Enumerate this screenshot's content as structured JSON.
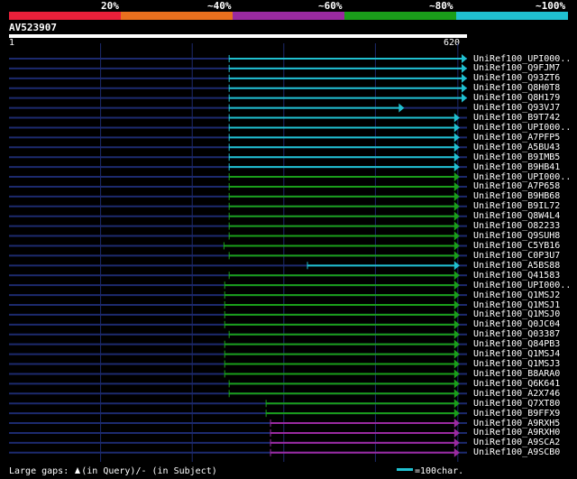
{
  "legend": {
    "segments": [
      {
        "label": "20%",
        "color": "#e8203a"
      },
      {
        "label": "~40%",
        "color": "#e8701e"
      },
      {
        "label": "~60%",
        "color": "#9a2aa0"
      },
      {
        "label": "~80%",
        "color": "#1a9e1a"
      },
      {
        "label": "~100%",
        "color": "#20c0d0"
      }
    ]
  },
  "query": {
    "name": "AV523907",
    "start": "1",
    "end": "620",
    "length": 620
  },
  "colors": {
    "query_line": "#1c2a6e",
    "grid": "#1c2a6e",
    "cyan": "#20c0d0",
    "green": "#1a9e1a",
    "purple": "#9a2aa0"
  },
  "hits": [
    {
      "name": "UniRef100_UPI000..",
      "start": 298,
      "end": 620,
      "color": "cyan"
    },
    {
      "name": "UniRef100_Q9FJM7",
      "start": 298,
      "end": 620,
      "color": "cyan"
    },
    {
      "name": "UniRef100_Q93ZT6",
      "start": 298,
      "end": 620,
      "color": "cyan"
    },
    {
      "name": "UniRef100_Q8H0T8",
      "start": 298,
      "end": 620,
      "color": "cyan"
    },
    {
      "name": "UniRef100_Q8H179",
      "start": 298,
      "end": 620,
      "color": "cyan"
    },
    {
      "name": "UniRef100_Q93VJ7",
      "start": 298,
      "end": 535,
      "color": "cyan"
    },
    {
      "name": "UniRef100_B9T742",
      "start": 298,
      "end": 610,
      "color": "cyan"
    },
    {
      "name": "UniRef100_UPI000..",
      "start": 298,
      "end": 610,
      "color": "cyan"
    },
    {
      "name": "UniRef100_A7PFP5",
      "start": 298,
      "end": 610,
      "color": "cyan"
    },
    {
      "name": "UniRef100_A5BU43",
      "start": 298,
      "end": 610,
      "color": "cyan"
    },
    {
      "name": "UniRef100_B9IMB5",
      "start": 298,
      "end": 610,
      "color": "cyan"
    },
    {
      "name": "UniRef100_B9HB41",
      "start": 298,
      "end": 610,
      "color": "cyan"
    },
    {
      "name": "UniRef100_UPI000..",
      "start": 298,
      "end": 610,
      "color": "green"
    },
    {
      "name": "UniRef100_A7P658",
      "start": 298,
      "end": 610,
      "color": "green"
    },
    {
      "name": "UniRef100_B9HB68",
      "start": 298,
      "end": 610,
      "color": "green"
    },
    {
      "name": "UniRef100_B9IL72",
      "start": 298,
      "end": 610,
      "color": "green"
    },
    {
      "name": "UniRef100_Q8W4L4",
      "start": 298,
      "end": 610,
      "color": "green"
    },
    {
      "name": "UniRef100_O82233",
      "start": 298,
      "end": 610,
      "color": "green"
    },
    {
      "name": "UniRef100_Q9SUH8",
      "start": 298,
      "end": 610,
      "color": "green"
    },
    {
      "name": "UniRef100_C5YB16",
      "start": 291,
      "end": 610,
      "color": "green"
    },
    {
      "name": "UniRef100_C0P3U7",
      "start": 298,
      "end": 610,
      "color": "green"
    },
    {
      "name": "UniRef100_A5BS88",
      "start": 404,
      "end": 610,
      "color": "cyan"
    },
    {
      "name": "UniRef100_Q41583",
      "start": 298,
      "end": 610,
      "color": "green"
    },
    {
      "name": "UniRef100_UPI000..",
      "start": 292,
      "end": 610,
      "color": "green"
    },
    {
      "name": "UniRef100_Q1MSJ2",
      "start": 292,
      "end": 610,
      "color": "green"
    },
    {
      "name": "UniRef100_Q1MSJ1",
      "start": 292,
      "end": 610,
      "color": "green"
    },
    {
      "name": "UniRef100_Q1MSJ0",
      "start": 292,
      "end": 610,
      "color": "green"
    },
    {
      "name": "UniRef100_Q0JC04",
      "start": 292,
      "end": 610,
      "color": "green"
    },
    {
      "name": "UniRef100_Q03387",
      "start": 298,
      "end": 610,
      "color": "green"
    },
    {
      "name": "UniRef100_Q84PB3",
      "start": 292,
      "end": 610,
      "color": "green"
    },
    {
      "name": "UniRef100_Q1MSJ4",
      "start": 292,
      "end": 610,
      "color": "green"
    },
    {
      "name": "UniRef100_Q1MSJ3",
      "start": 292,
      "end": 610,
      "color": "green"
    },
    {
      "name": "UniRef100_B8ARA0",
      "start": 292,
      "end": 610,
      "color": "green"
    },
    {
      "name": "UniRef100_Q6K641",
      "start": 298,
      "end": 610,
      "color": "green"
    },
    {
      "name": "UniRef100_A2X746",
      "start": 298,
      "end": 610,
      "color": "green"
    },
    {
      "name": "UniRef100_Q7XT80",
      "start": 348,
      "end": 610,
      "color": "green"
    },
    {
      "name": "UniRef100_B9FFX9",
      "start": 348,
      "end": 610,
      "color": "green"
    },
    {
      "name": "UniRef100_A9RXH5",
      "start": 354,
      "end": 610,
      "color": "purple"
    },
    {
      "name": "UniRef100_A9RXH0",
      "start": 354,
      "end": 610,
      "color": "purple"
    },
    {
      "name": "UniRef100_A9SCA2",
      "start": 354,
      "end": 610,
      "color": "purple"
    },
    {
      "name": "UniRef100_A9SCB0",
      "start": 354,
      "end": 610,
      "color": "purple"
    }
  ],
  "footer": {
    "gaps_prefix": "Large gaps: ",
    "gaps_suffix": "(in Query)/- (in Subject)",
    "scale_label": "=100char."
  }
}
